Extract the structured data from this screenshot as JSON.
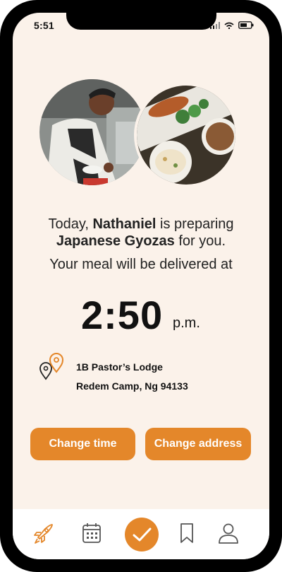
{
  "status_bar": {
    "time": "5:51"
  },
  "message": {
    "prefix": "Today, ",
    "chef_name": "Nathaniel",
    "middle": " is  preparing",
    "dish": "Japanese Gyozas",
    "suffix": " for you.",
    "delivery_line": "Your meal will be delivered at"
  },
  "delivery_time": {
    "time": "2:50",
    "ampm": "p.m."
  },
  "address": {
    "line1": "1B Pastor’s Lodge",
    "line2": "Redem Camp, Ng 94133"
  },
  "buttons": {
    "change_time": "Change time",
    "change_address": "Change address"
  },
  "colors": {
    "accent": "#e4872a",
    "background": "#fbf2ea"
  },
  "tabbar": {
    "items": [
      "rocket-icon",
      "calendar-icon",
      "check-icon",
      "bookmark-icon",
      "profile-icon"
    ],
    "active": "check-icon"
  }
}
